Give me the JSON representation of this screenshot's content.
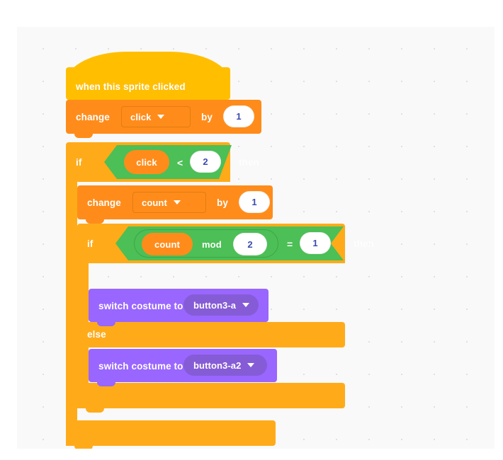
{
  "app": {
    "kind": "scratch-block-editor",
    "canvas_background": "#f9f9f9",
    "page_background": "#ffffff"
  },
  "palette": {
    "events_yellow": "#ffbf00",
    "control_orange": "#ffab19",
    "variables_orange": "#ff8c1a",
    "operators_green": "#4cbf56",
    "looks_purple": "#9966ff",
    "looks_purple_dark": "#855cd6",
    "input_white": "#ffffff",
    "input_text": "#3b4bb0",
    "grid_dot": "#e0e0e0"
  },
  "script": {
    "hat": {
      "label": "when this sprite clicked",
      "category": "events"
    },
    "change_click": {
      "verb": "change",
      "variable": "click",
      "connector": "by",
      "value": "1",
      "category": "variables"
    },
    "if_outer": {
      "keyword": "if",
      "then": "then",
      "category": "control",
      "condition": {
        "left_variable": "click",
        "operator": "<",
        "right_value": "2",
        "category": "operators"
      }
    },
    "change_count": {
      "verb": "change",
      "variable": "count",
      "connector": "by",
      "value": "1",
      "category": "variables"
    },
    "if_inner": {
      "keyword": "if",
      "then": "then",
      "else": "else",
      "category": "control",
      "condition": {
        "operator": "=",
        "right_value": "1",
        "category": "operators",
        "inner": {
          "left_variable": "count",
          "operator": "mod",
          "right_value": "2",
          "category": "operators"
        }
      }
    },
    "switch_true": {
      "label": "switch costume to",
      "costume": "button3-a",
      "category": "looks"
    },
    "switch_false": {
      "label": "switch costume to",
      "costume": "button3-a2",
      "category": "looks"
    }
  },
  "icons": {
    "dropdown_arrow": "chevron-down-icon"
  }
}
